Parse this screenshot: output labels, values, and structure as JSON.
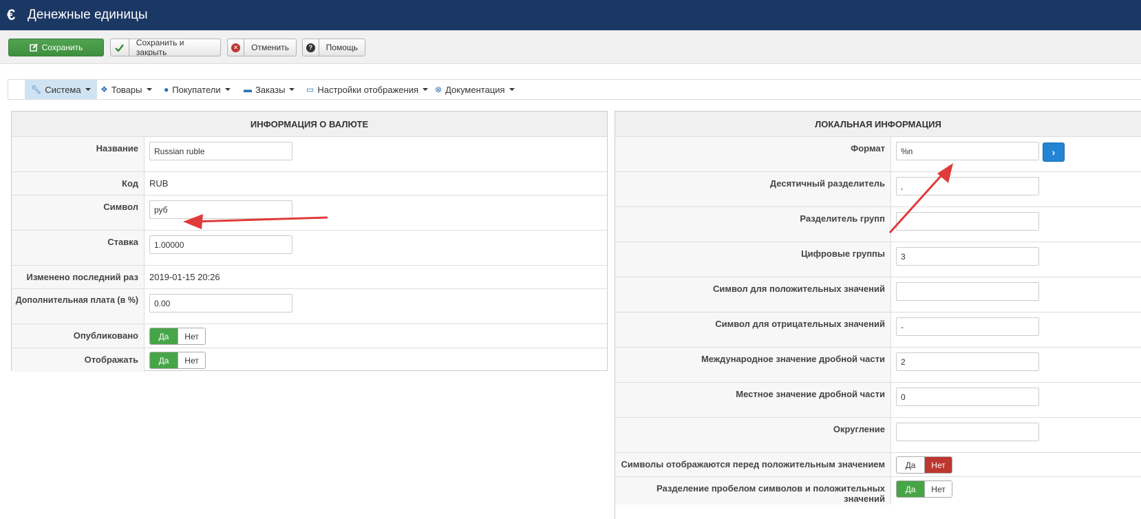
{
  "header": {
    "icon": "euro-icon",
    "title": "Денежные единицы"
  },
  "toolbar": {
    "save": "Сохранить",
    "save_close": "Сохранить и закрыть",
    "cancel": "Отменить",
    "help": "Помощь"
  },
  "menu": [
    {
      "label": "Система",
      "icon": "wrench-icon"
    },
    {
      "label": "Товары",
      "icon": "cubes-icon"
    },
    {
      "label": "Покупатели",
      "icon": "user-icon"
    },
    {
      "label": "Заказы",
      "icon": "credit-card-icon"
    },
    {
      "label": "Настройки отображения",
      "icon": "monitor-icon"
    },
    {
      "label": "Документация",
      "icon": "lifebuoy-icon"
    }
  ],
  "currency_info": {
    "title": "ИНФОРМАЦИЯ О ВАЛЮТЕ",
    "name_label": "Название",
    "name_value": "Russian ruble",
    "code_label": "Код",
    "code_value": "RUB",
    "symbol_label": "Символ",
    "symbol_value": "руб",
    "rate_label": "Ставка",
    "rate_value": "1.00000",
    "modified_label": "Изменено последний раз",
    "modified_value": "2019-01-15 20:26",
    "fee_label": "Дополнительная плата (в %)",
    "fee_value": "0.00",
    "published_label": "Опубликовано",
    "display_label": "Отображать",
    "yes": "Да",
    "no": "Нет"
  },
  "local_info": {
    "title": "ЛОКАЛЬНАЯ ИНФОРМАЦИЯ",
    "format_label": "Формат",
    "format_value": "%n",
    "decimal_sep_label": "Десятичный разделитель",
    "decimal_sep_value": ",",
    "group_sep_label": "Разделитель групп",
    "group_sep_value": "",
    "digit_groups_label": "Цифровые группы",
    "digit_groups_value": "3",
    "pos_symbol_label": "Символ для положительных значений",
    "pos_symbol_value": "",
    "neg_symbol_label": "Символ для отрицательных значений",
    "neg_symbol_value": "-",
    "intl_frac_label": "Международное значение дробной части",
    "intl_frac_value": "2",
    "local_frac_label": "Местное значение дробной части",
    "local_frac_value": "0",
    "rounding_label": "Округление",
    "rounding_value": "",
    "symbols_before_label": "Символы отображаются перед положительным значением",
    "space_sep_label": "Разделение пробелом символов и положительных значений",
    "yes": "Да",
    "no": "Нет"
  },
  "colors": {
    "header": "#1b3764",
    "save": "#46a546",
    "no_active": "#bd362f",
    "arrow": "#e03a3a"
  }
}
